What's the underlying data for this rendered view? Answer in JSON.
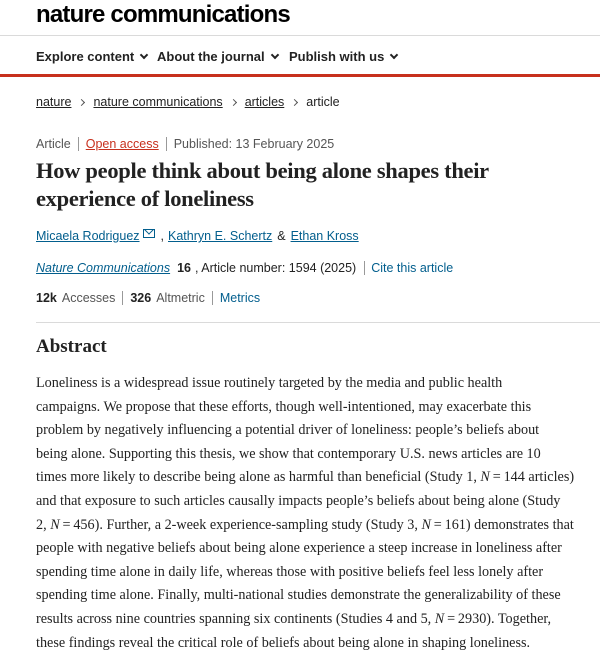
{
  "brand": "nature communications",
  "nav": {
    "items": [
      "Explore content",
      "About the journal",
      "Publish with us"
    ]
  },
  "breadcrumb": {
    "items": [
      "nature",
      "nature communications",
      "articles"
    ],
    "current": "article"
  },
  "meta": {
    "type": "Article",
    "access": "Open access",
    "published": "Published: 13 February 2025"
  },
  "title": "How people think about being alone shapes their experience of loneliness",
  "authors": {
    "list": [
      "Micaela Rodriguez",
      "Kathryn E. Schertz",
      "Ethan Kross"
    ],
    "and": "&"
  },
  "citation": {
    "journal": "Nature Communications",
    "volume": "16",
    "details": ", Article number: 1594 (2025)",
    "cite_link": "Cite this article"
  },
  "metrics": {
    "accesses_count": "12k",
    "accesses_label": "Accesses",
    "altmetric_count": "326",
    "altmetric_label": "Altmetric",
    "metrics_link": "Metrics"
  },
  "abstract": {
    "heading": "Abstract",
    "lines": [
      "Loneliness is a widespread issue routinely targeted by the media and public health",
      "campaigns. We propose that these efforts, though well-intentioned, may exacerbate this",
      "problem by negatively influencing a potential driver of loneliness: people’s beliefs about",
      "being alone. Supporting this thesis, we show that contemporary U.S. news articles are 10",
      "times more likely to describe being alone as harmful than beneficial (Study 1, N = 144 articles)",
      "and that exposure to such articles causally impacts people’s beliefs about being alone (Study",
      "2, N = 456). Further, a 2-week experience-sampling study (Study 3, N = 161) demonstrates that",
      "people with negative beliefs about being alone experience a steep increase in loneliness after",
      "spending time alone in daily life, whereas those with positive beliefs feel less lonely after",
      "spending time alone. Finally, multi-national studies demonstrate the generalizability of these",
      "results across nine countries spanning six continents (Studies 4 and 5, N = 2930). Together,",
      "these findings reveal the critical role of beliefs about being alone in shaping loneliness."
    ]
  }
}
